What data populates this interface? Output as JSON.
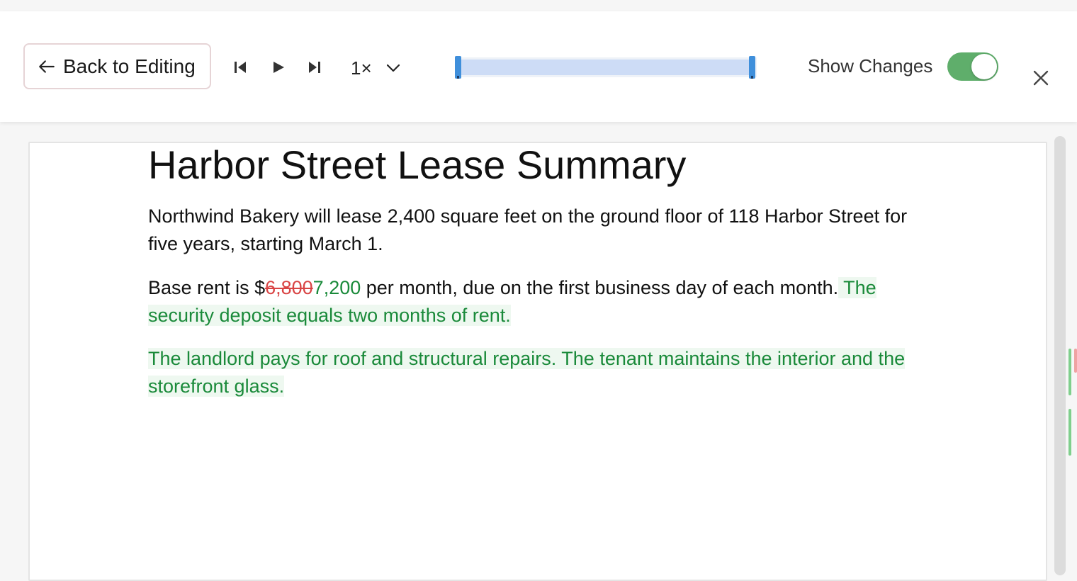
{
  "toolbar": {
    "back_label": "Back to Editing",
    "speed_label": "1×",
    "show_changes_label": "Show Changes",
    "show_changes_on": true,
    "accent_color": "#3f8fdb",
    "toggle_color": "#5fae6b",
    "icons": [
      "arrow-left-icon",
      "skip-to-start-icon",
      "play-icon",
      "skip-to-end-icon",
      "chevron-down-icon",
      "close-icon"
    ]
  },
  "document": {
    "title": "Harbor Street Lease Summary",
    "para1": "Northwind Bakery will lease 2,400 square feet on the ground floor of 118 Harbor Street for five years, starting March 1.",
    "para2": {
      "prefix": "Base rent is $",
      "removed": "6,800",
      "added": "7,200",
      "middle": " per month, due on the first business day of each month.",
      "added_sentence": " The security deposit equals two months of rent."
    },
    "para3_added": "The landlord pays for roof and structural repairs. The tenant maintains the interior and the storefront glass.",
    "colors": {
      "removed": "#d94444",
      "added": "#1a8a3a",
      "added_background": "#eef8f0"
    }
  }
}
